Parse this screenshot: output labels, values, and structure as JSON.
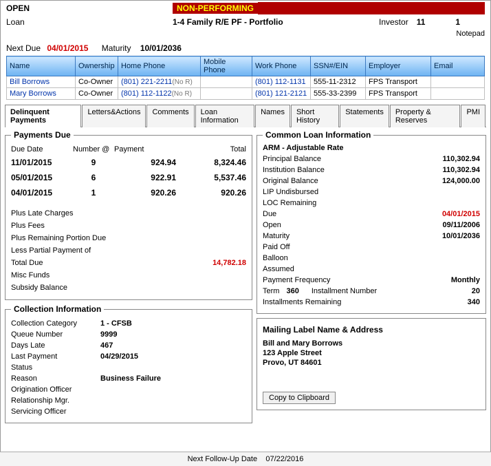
{
  "header": {
    "open": "OPEN",
    "status": "NON-PERFORMING",
    "loan_label": "Loan",
    "loan_type": "1-4 Family R/E PF - Portfolio",
    "investor_label": "Investor",
    "investor1": "11",
    "investor2": "1",
    "notepad": "Notepad",
    "next_due_label": "Next Due",
    "next_due_value": "04/01/2015",
    "maturity_label": "Maturity",
    "maturity_value": "10/01/2036"
  },
  "grid": {
    "headers": {
      "name": "Name",
      "ownership": "Ownership",
      "home": "Home Phone",
      "mobile": "Mobile Phone",
      "work": "Work Phone",
      "ssn": "SSN#/EIN",
      "employer": "Employer",
      "email": "Email"
    },
    "rows": [
      {
        "name": "Bill Borrows",
        "ownership": "Co-Owner",
        "home": "(801) 221-2211",
        "home_flag": "(No R)",
        "mobile": "",
        "work": "(801) 112-1131",
        "ssn": "555-11-2312",
        "employer": "FPS Transport",
        "email": ""
      },
      {
        "name": "Mary Borrows",
        "ownership": "Co-Owner",
        "home": "(801) 112-1122",
        "home_flag": "(No R)",
        "mobile": "",
        "work": "(801) 121-2121",
        "ssn": "555-33-2399",
        "employer": "FPS Transport",
        "email": ""
      }
    ]
  },
  "tabs": [
    "Delinquent Payments",
    "Letters&Actions",
    "Comments",
    "Loan Information",
    "Names",
    "Short History",
    "Statements",
    "Property & Reserves",
    "PMI"
  ],
  "payments_due": {
    "legend": "Payments Due",
    "headers": {
      "due": "Due Date",
      "num_at": "Number  @",
      "payment": "Payment",
      "total": "Total"
    },
    "rows": [
      {
        "date": "11/01/2015",
        "num": "9",
        "payment": "924.94",
        "total": "8,324.46"
      },
      {
        "date": "05/01/2015",
        "num": "6",
        "payment": "922.91",
        "total": "5,537.46"
      },
      {
        "date": "04/01/2015",
        "num": "1",
        "payment": "920.26",
        "total": "920.26"
      }
    ],
    "lines": {
      "plus_late": "Plus Late Charges",
      "plus_fees": "Plus Fees",
      "plus_remaining": "Plus Remaining Portion Due",
      "less_partial": "Less Partial Payment of",
      "total_due_label": "Total Due",
      "total_due_value": "14,782.18",
      "misc": "Misc Funds",
      "subsidy": "Subsidy Balance"
    }
  },
  "collection": {
    "legend": "Collection Information",
    "category_label": "Collection Category",
    "category": "1 - CFSB",
    "queue_label": "Queue Number",
    "queue": "9999",
    "days_late_label": "Days Late",
    "days_late": "467",
    "last_payment_label": "Last Payment",
    "last_payment": "04/29/2015",
    "status_label": "Status",
    "status": "",
    "reason_label": "Reason",
    "reason": "Business Failure",
    "orig_label": "Origination Officer",
    "orig": "",
    "rel_label": "Relationship Mgr.",
    "rel": "",
    "serv_label": "Servicing Officer",
    "serv": ""
  },
  "loan_info": {
    "legend": "Common Loan Information",
    "subtitle": "ARM - Adjustable Rate",
    "principal_label": "Principal Balance",
    "principal": "110,302.94",
    "inst_label": "Institution Balance",
    "inst": "110,302.94",
    "orig_label": "Original Balance",
    "orig": "124,000.00",
    "lip_label": "LIP Undisbursed",
    "lip": "",
    "loc_label": "LOC Remaining",
    "loc": "",
    "due_label": "Due",
    "due": "04/01/2015",
    "open_label": "Open",
    "open": "09/11/2006",
    "maturity_label": "Maturity",
    "maturity": "10/01/2036",
    "paidoff_label": "Paid Off",
    "paidoff": "",
    "balloon_label": "Balloon",
    "balloon": "",
    "assumed_label": "Assumed",
    "assumed": "",
    "freq_label": "Payment Frequency",
    "freq": "Monthly",
    "term_label": "Term",
    "term": "360",
    "install_num_label": "Installment Number",
    "install_num": "20",
    "install_rem_label": "Installments Remaining",
    "install_rem": "340"
  },
  "mail": {
    "title": "Mailing Label Name & Address",
    "line1": "Bill and Mary Borrows",
    "line2": "123 Apple Street",
    "line3": "Provo, UT  84601",
    "button": "Copy to Clipboard"
  },
  "footer": {
    "label": "Next Follow-Up Date",
    "value": "07/22/2016"
  }
}
